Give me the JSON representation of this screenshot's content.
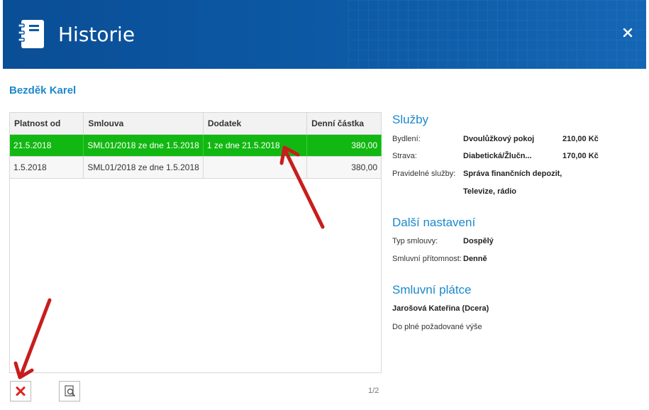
{
  "window": {
    "title": "Historie",
    "icon": "notebook-icon",
    "close_icon": "close-icon"
  },
  "person_name": "Bezděk Karel",
  "table": {
    "columns": [
      "Platnost od",
      "Smlouva",
      "Dodatek",
      "Denní částka"
    ],
    "rows": [
      {
        "platnost_od": "21.5.2018",
        "smlouva": "SML01/2018 ze dne 1.5.2018",
        "dodatek": "1 ze dne 21.5.2018",
        "castka": "380,00",
        "selected": true
      },
      {
        "platnost_od": "1.5.2018",
        "smlouva": "SML01/2018 ze dne 1.5.2018",
        "dodatek": "",
        "castka": "380,00",
        "selected": false
      }
    ]
  },
  "sluzby": {
    "title": "Služby",
    "bydleni_label": "Bydlení:",
    "bydleni_value": "Dvoulůžkový pokoj",
    "bydleni_price": "210,00 Kč",
    "strava_label": "Strava:",
    "strava_value": "Diabetická/Žlučn...",
    "strava_price": "170,00 Kč",
    "pravidelne_label": "Pravidelné služby:",
    "pravidelne_value_1": "Správa finančních depozit,",
    "pravidelne_value_2": "Televize, rádio"
  },
  "dalsi_nastaveni": {
    "title": "Další nastavení",
    "typ_label": "Typ smlouvy:",
    "typ_value": "Dospělý",
    "pritomnost_label": "Smluvní přítomnost:",
    "pritomnost_value": "Denně"
  },
  "platce": {
    "title": "Smluvní plátce",
    "name": "Jarošová Kateřina (Dcera)",
    "note": "Do plné požadované výše"
  },
  "footer": {
    "delete_icon": "delete-x-icon",
    "preview_icon": "search-document-icon",
    "pager": "1/2"
  },
  "colors": {
    "header": "#0d5aa6",
    "accent": "#1b88cc",
    "selected_row": "#12b812",
    "annotation_arrow": "#cc1f1f"
  }
}
